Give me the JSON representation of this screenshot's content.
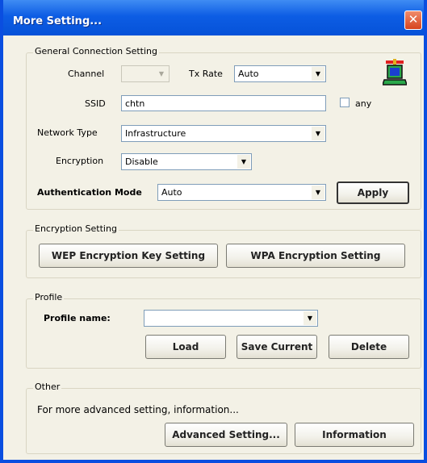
{
  "window": {
    "title": "More Setting...",
    "close_glyph": "✕"
  },
  "general": {
    "group_label": "General Connection Setting",
    "channel_label": "Channel",
    "channel_value": "",
    "tx_rate_label": "Tx Rate",
    "tx_rate_value": "Auto",
    "ssid_label": "SSID",
    "ssid_value": "chtn",
    "any_label": "any",
    "network_type_label": "Network Type",
    "network_type_value": "Infrastructure",
    "encryption_label": "Encryption",
    "encryption_value": "Disable",
    "auth_mode_label": "Authentication Mode",
    "auth_mode_value": "Auto",
    "apply_label": "Apply",
    "network_icon": "network-computer-icon"
  },
  "encryption_setting": {
    "group_label": "Encryption Setting",
    "wep_button": "WEP Encryption Key Setting",
    "wpa_button": "WPA Encryption Setting"
  },
  "profile": {
    "group_label": "Profile",
    "name_label": "Profile name:",
    "name_value": "",
    "load_button": "Load",
    "save_button": "Save Current",
    "delete_button": "Delete"
  },
  "other": {
    "group_label": "Other",
    "info_text": "For more advanced setting, information...",
    "advanced_button": "Advanced Setting...",
    "information_button": "Information"
  },
  "colors": {
    "titlebar": "#0d5de4",
    "dialog_bg": "#f3f1e6",
    "close": "#d6431e"
  }
}
